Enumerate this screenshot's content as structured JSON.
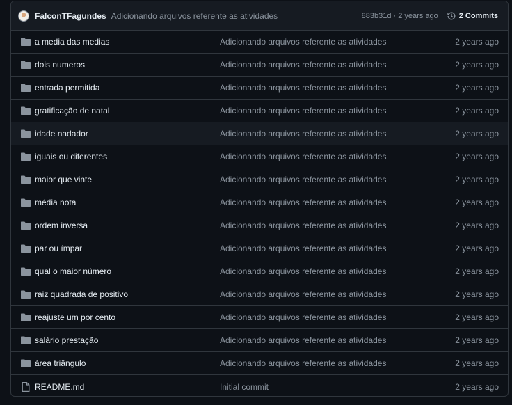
{
  "header": {
    "author": "FalconTFagundes",
    "message": "Adicionando arquivos referente as atividades",
    "meta": "883b31d · 2 years ago",
    "commits": "2 Commits"
  },
  "colors": {
    "background": "#0d1117",
    "header_bg": "#161b22",
    "border": "#30363d",
    "text": "#e6edf3",
    "muted": "#8b949e",
    "folder_icon": "#8b949e"
  },
  "rows": [
    {
      "type": "folder",
      "icon": "folder-icon",
      "name": "a media das medias",
      "message": "Adicionando arquivos referente as atividades",
      "age": "2 years ago"
    },
    {
      "type": "folder",
      "icon": "folder-icon",
      "name": "dois numeros",
      "message": "Adicionando arquivos referente as atividades",
      "age": "2 years ago"
    },
    {
      "type": "folder",
      "icon": "folder-icon",
      "name": "entrada permitida",
      "message": "Adicionando arquivos referente as atividades",
      "age": "2 years ago"
    },
    {
      "type": "folder",
      "icon": "folder-icon",
      "name": "gratificação de natal",
      "message": "Adicionando arquivos referente as atividades",
      "age": "2 years ago"
    },
    {
      "type": "folder",
      "icon": "folder-icon",
      "name": "idade nadador",
      "message": "Adicionando arquivos referente as atividades",
      "age": "2 years ago"
    },
    {
      "type": "folder",
      "icon": "folder-icon",
      "name": "iguais ou diferentes",
      "message": "Adicionando arquivos referente as atividades",
      "age": "2 years ago"
    },
    {
      "type": "folder",
      "icon": "folder-icon",
      "name": "maior que vinte",
      "message": "Adicionando arquivos referente as atividades",
      "age": "2 years ago"
    },
    {
      "type": "folder",
      "icon": "folder-icon",
      "name": "média nota",
      "message": "Adicionando arquivos referente as atividades",
      "age": "2 years ago"
    },
    {
      "type": "folder",
      "icon": "folder-icon",
      "name": "ordem inversa",
      "message": "Adicionando arquivos referente as atividades",
      "age": "2 years ago"
    },
    {
      "type": "folder",
      "icon": "folder-icon",
      "name": "par ou ímpar",
      "message": "Adicionando arquivos referente as atividades",
      "age": "2 years ago"
    },
    {
      "type": "folder",
      "icon": "folder-icon",
      "name": "qual o maior número",
      "message": "Adicionando arquivos referente as atividades",
      "age": "2 years ago"
    },
    {
      "type": "folder",
      "icon": "folder-icon",
      "name": "raiz quadrada de positivo",
      "message": "Adicionando arquivos referente as atividades",
      "age": "2 years ago"
    },
    {
      "type": "folder",
      "icon": "folder-icon",
      "name": "reajuste um por cento",
      "message": "Adicionando arquivos referente as atividades",
      "age": "2 years ago"
    },
    {
      "type": "folder",
      "icon": "folder-icon",
      "name": "salário prestação",
      "message": "Adicionando arquivos referente as atividades",
      "age": "2 years ago"
    },
    {
      "type": "folder",
      "icon": "folder-icon",
      "name": "área triângulo",
      "message": "Adicionando arquivos referente as atividades",
      "age": "2 years ago"
    },
    {
      "type": "file",
      "icon": "file-icon",
      "name": "README.md",
      "message": "Initial commit",
      "age": "2 years ago"
    }
  ]
}
